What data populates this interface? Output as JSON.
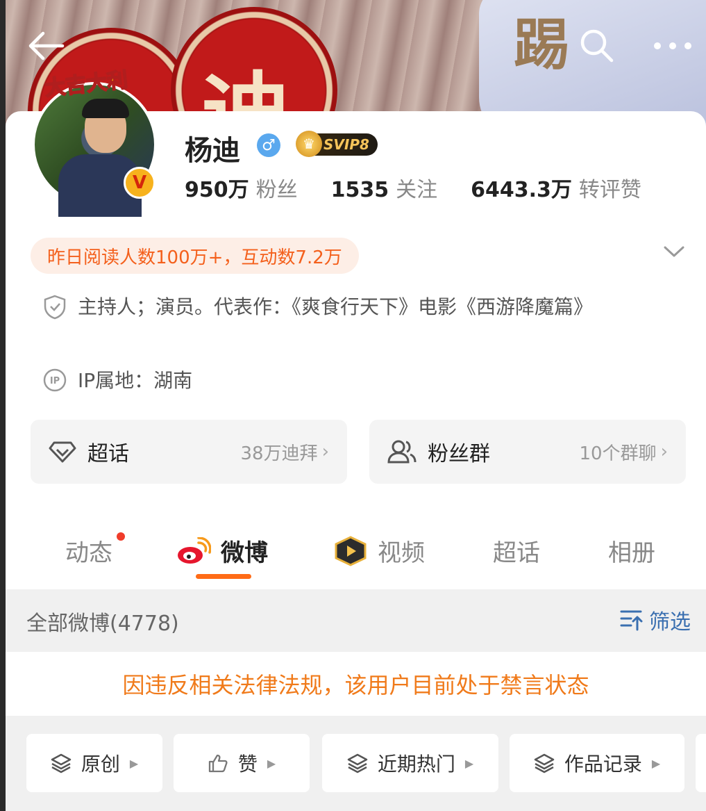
{
  "profile": {
    "name": "杨迪",
    "vip_label": "SVIP8",
    "verified_mark": "V",
    "sticker_text": "大吉大利",
    "gender_symbol": "♂",
    "stats": [
      {
        "value": "950万",
        "label": "粉丝"
      },
      {
        "value": "1535",
        "label": "关注"
      },
      {
        "value": "6443.3万",
        "label": "转评赞"
      }
    ]
  },
  "banner": {
    "glyph_1": "迪",
    "glyph_2": "踢"
  },
  "read_badge": "昨日阅读人数100万+，互动数7.2万",
  "bio": "主持人；演员。代表作：《爽食行天下》电影《西游降魔篇》",
  "ip_location": "IP属地：湖南",
  "pills": [
    {
      "label": "超话",
      "value": "38万迪拜"
    },
    {
      "label": "粉丝群",
      "value": "10个群聊"
    }
  ],
  "tabs": [
    {
      "label": "动态"
    },
    {
      "label": "微博"
    },
    {
      "label": "视频"
    },
    {
      "label": "超话"
    },
    {
      "label": "相册"
    }
  ],
  "filter": {
    "title": "全部微博(4778)",
    "button": "筛选"
  },
  "banned_notice": "因违反相关法律法规，该用户目前处于禁言状态",
  "chips": [
    {
      "label": "原创"
    },
    {
      "label": "赞"
    },
    {
      "label": "近期热门"
    },
    {
      "label": "作品记录"
    }
  ],
  "icons": [
    "back-arrow-icon",
    "search-icon",
    "more-icon",
    "shield-icon",
    "ip-icon",
    "diamond-icon",
    "group-icon",
    "weibo-logo-icon",
    "video-icon",
    "filter-icon",
    "layers-icon",
    "thumbs-up-icon"
  ],
  "colors": {
    "accent_orange": "#ff6b16",
    "banned_text": "#f07a1a",
    "link_blue": "#3a6fb0"
  }
}
